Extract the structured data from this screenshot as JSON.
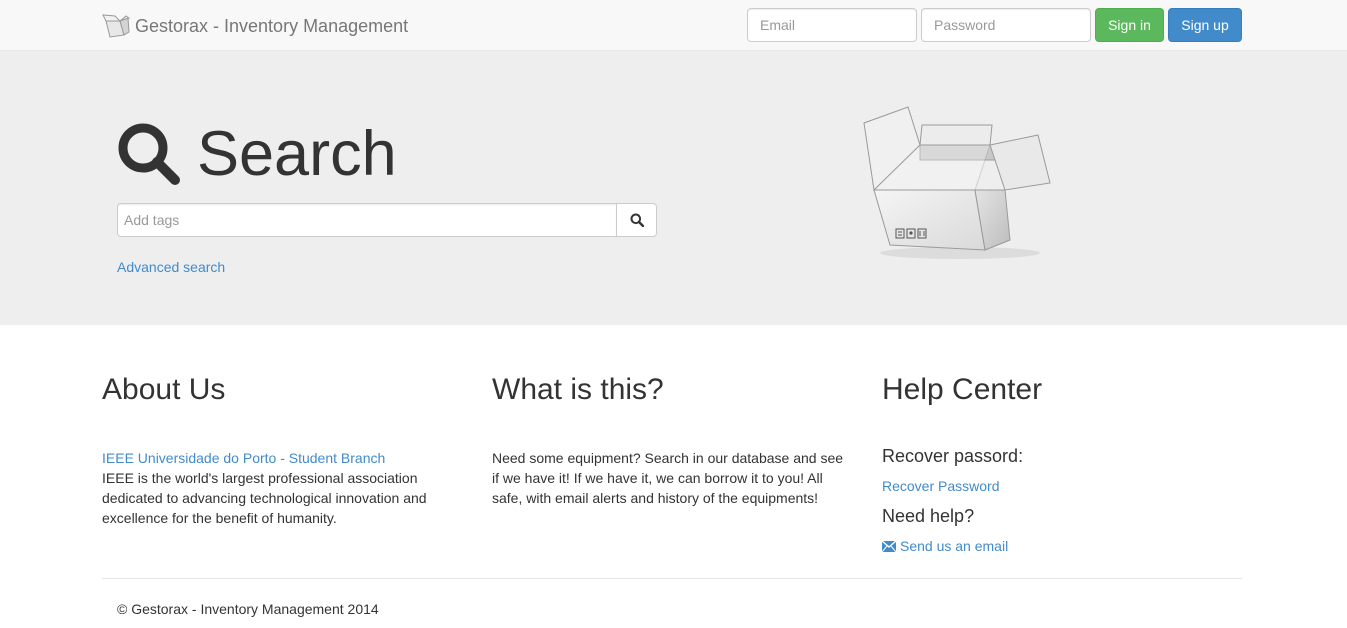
{
  "navbar": {
    "brand_icon": "box-logo-icon",
    "brand_title": "Gestorax - Inventory Management",
    "email_placeholder": "Email",
    "password_placeholder": "Password",
    "signin_label": "Sign in",
    "signup_label": "Sign up"
  },
  "hero": {
    "heading_icon": "magnifier-icon",
    "heading": "Search",
    "tags_placeholder": "Add tags",
    "search_button_icon": "search-icon",
    "advanced_link": "Advanced search",
    "illustration": "open-cardboard-box"
  },
  "about": {
    "title": "About Us",
    "link": "IEEE Universidade do Porto - Student Branch",
    "text": "IEEE is the world's largest professional association dedicated to advancing technological innovation and excellence for the benefit of humanity."
  },
  "what": {
    "title": "What is this?",
    "text": "Need some equipment? Search in our database and see if we have it! If we have it, we can borrow it to you! All safe, with email alerts and history of the equipments!"
  },
  "help": {
    "title": "Help Center",
    "recover_heading": "Recover passord:",
    "recover_link": "Recover Password",
    "need_help_heading": "Need help?",
    "email_icon": "envelope-icon",
    "email_link": "Send us an email"
  },
  "footer": {
    "copyright": "© Gestorax - Inventory Management 2014"
  },
  "colors": {
    "link": "#428bca",
    "success": "#5cb85c",
    "primary": "#428bca",
    "jumbotron_bg": "#eeeeee",
    "navbar_bg": "#f8f8f8"
  }
}
